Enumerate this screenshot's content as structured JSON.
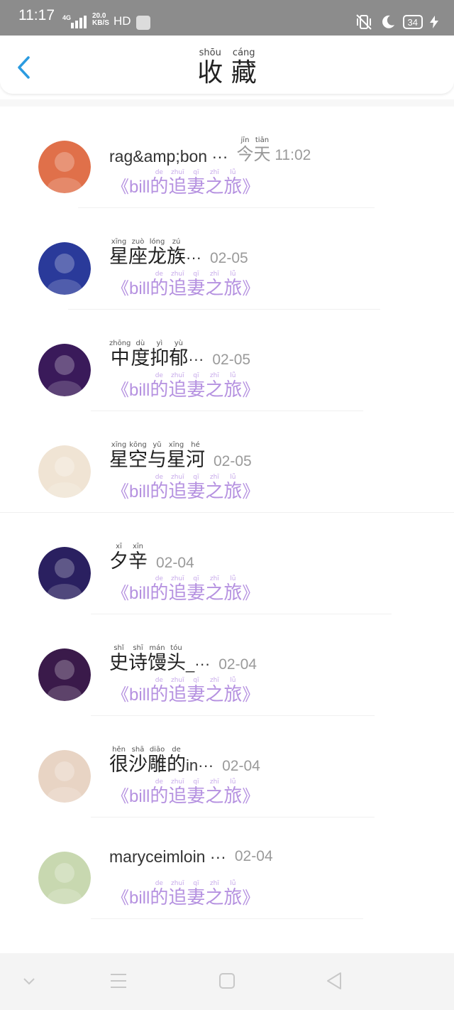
{
  "status": {
    "time": "11:17",
    "network": "4G",
    "speed_line1": "20.0",
    "speed_line2": "KB/S",
    "hd": "HD",
    "battery": "34"
  },
  "header": {
    "title_chars": [
      "收",
      "藏"
    ],
    "title_pinyin": [
      "shōu",
      "cáng"
    ]
  },
  "items": [
    {
      "name": "rag&amp;bon ···",
      "date_chars": [
        "今",
        "天"
      ],
      "date_pinyin": [
        "jīn",
        "tiān"
      ],
      "time": "11:02",
      "avatar_color": "#e0704a"
    },
    {
      "name_chars": [
        "星",
        "座",
        "龙",
        "族"
      ],
      "name_pinyin": [
        "xīng",
        "zuò",
        "lóng",
        "zú"
      ],
      "name_suffix": "···",
      "date": "02-05",
      "avatar_color": "#2a3a9a"
    },
    {
      "name_chars": [
        "中",
        "度",
        "抑",
        "郁"
      ],
      "name_pinyin": [
        "zhōng",
        "dù",
        "yì",
        "yù"
      ],
      "name_suffix": "···",
      "date": "02-05",
      "avatar_color": "#3a1a5a"
    },
    {
      "name_chars": [
        "星",
        "空",
        "与",
        "星",
        "河"
      ],
      "name_pinyin": [
        "xīng",
        "kōng",
        "yǔ",
        "xīng",
        "hé"
      ],
      "name_suffix": "",
      "date": "02-05",
      "avatar_color": "#f0e4d4"
    },
    {
      "name_chars": [
        "夕",
        "辛"
      ],
      "name_pinyin": [
        "xī",
        "xīn"
      ],
      "name_suffix": "",
      "date": "02-04",
      "avatar_color": "#2a2060"
    },
    {
      "name_chars": [
        "史",
        "诗",
        "馒",
        "头"
      ],
      "name_pinyin": [
        "shǐ",
        "shī",
        "mán",
        "tóu"
      ],
      "name_suffix": "_···",
      "date": "02-04",
      "avatar_color": "#3a1a4a"
    },
    {
      "name_chars": [
        "很",
        "沙",
        "雕",
        "的"
      ],
      "name_pinyin": [
        "hěn",
        "shā",
        "diāo",
        "de"
      ],
      "name_suffix": "in···",
      "date": "02-04",
      "avatar_color": "#e8d4c4"
    },
    {
      "name": "maryceimloin ···",
      "date": "02-04",
      "avatar_color": "#c8d8b0"
    }
  ],
  "book": {
    "open": "《",
    "prefix": "bill",
    "chars": [
      "的",
      "追",
      "妻",
      "之",
      "旅"
    ],
    "pinyin": [
      "de",
      "zhuī",
      "qī",
      "zhī",
      "lǚ"
    ],
    "close": "》"
  },
  "icons": {
    "back": "chevron-left-icon",
    "nav": [
      "chevron-down-icon",
      "menu-icon",
      "home-square-icon",
      "back-triangle-icon"
    ]
  }
}
